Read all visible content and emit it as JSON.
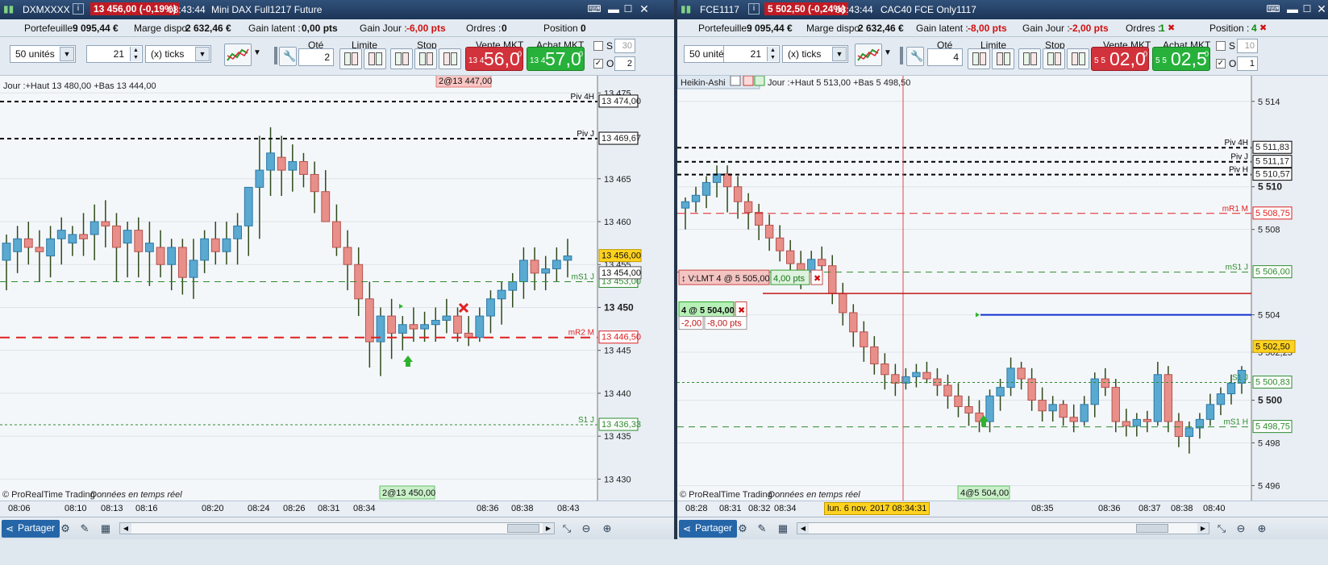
{
  "left": {
    "title": {
      "name": "DXMXXXX",
      "change": "13 456,00 (-0,19%)",
      "time": "08:43:44",
      "desc": "Mini DAX Full1217 Future"
    },
    "stats": {
      "portfolio_label": "Portefeuille :",
      "portfolio": "9 095,44 €",
      "margin_label": "Marge dispo",
      "margin": "2 632,46 €",
      "latent_label": "Gain latent :",
      "latent": "0,00 pts",
      "day_label": "Gain Jour :",
      "day": "-6,00 pts",
      "orders_label": "Ordres :",
      "orders": "0",
      "position_label": "Position :",
      "position": "0"
    },
    "toolbar": {
      "units": "50 unités",
      "qty_spin": "21",
      "ticks": "(x) ticks",
      "qty_label": "Qté",
      "qty": "2",
      "limit_label": "Limite",
      "stop_label": "Stop",
      "sell_label": "Vente MKT",
      "sell_small": "13 4",
      "sell_big": "56,0",
      "sell_sup": "0",
      "buy_label": "Achat MKT",
      "buy_small": "13 4",
      "buy_big": "57,0",
      "buy_sup": "0",
      "s_label": "S",
      "s_val": "30",
      "o_label": "O",
      "o_val": "2"
    },
    "chart": {
      "info": "Jour :+Haut 13 480,00 +Bas 13 444,00",
      "top_tag": "2@13 447,00",
      "bottom_tag": "2@13 450,00",
      "copyright": "© ProRealTime Trading",
      "realtime": "Données en temps réel"
    },
    "levels": [
      {
        "name": "Piv 4H",
        "value": "13 474,00",
        "price": 13474,
        "color": "#000",
        "dash": "5,4",
        "w": 2
      },
      {
        "name": "Piv J",
        "value": "13 469,67",
        "price": 13469.67,
        "color": "#000",
        "dash": "5,4",
        "w": 2
      },
      {
        "name": "mS1 J",
        "value": "13 453,00",
        "price": 13453,
        "color": "#2e8b2e",
        "dash": "8,6",
        "w": 1
      },
      {
        "name": "mR2 M",
        "value": "13 446,50",
        "price": 13446.5,
        "color": "#e02020",
        "dash": "12,8",
        "w": 2
      },
      {
        "name": "S1 J",
        "value": "13 436,33",
        "price": 13436.33,
        "color": "#2e8b2e",
        "dash": "3,3",
        "w": 1
      }
    ],
    "price_ticks": [
      "13 475",
      "13 465",
      "13 460",
      "13 455",
      "13 450",
      "13 445",
      "13 440",
      "13 435",
      "13 430"
    ],
    "price_tick_values": [
      13475,
      13465,
      13460,
      13455,
      13450,
      13445,
      13440,
      13435,
      13430
    ],
    "price_ymin": 13427.5,
    "price_ymax": 13477,
    "current": {
      "value": "13 456,00",
      "price": 13456
    },
    "bid": {
      "value": "13 454,00",
      "price": 13454
    },
    "time_ticks": [
      "08:06",
      "08:10",
      "08:13",
      "08:16",
      "08:20",
      "08:24",
      "08:26",
      "08:31",
      "08:34",
      "08:36",
      "08:38",
      "08:43"
    ],
    "candles": [
      [
        13455.5,
        13458.5,
        13452,
        13457.5
      ],
      [
        13456.5,
        13459.5,
        13454,
        13458
      ],
      [
        13458,
        13460,
        13455,
        13457
      ],
      [
        13457,
        13459,
        13453,
        13456.5
      ],
      [
        13456,
        13459.5,
        13453.5,
        13458
      ],
      [
        13458,
        13460.5,
        13455,
        13459
      ],
      [
        13457.5,
        13459.5,
        13456,
        13458.5
      ],
      [
        13458.5,
        13461,
        13456,
        13458
      ],
      [
        13458.5,
        13462,
        13455.5,
        13460
      ],
      [
        13460,
        13462.5,
        13457,
        13459.5
      ],
      [
        13459.5,
        13461,
        13453,
        13457
      ],
      [
        13457.5,
        13460,
        13453.5,
        13459
      ],
      [
        13459,
        13460.5,
        13453.5,
        13456.5
      ],
      [
        13456.5,
        13460,
        13452.5,
        13457.5
      ],
      [
        13457,
        13459,
        13453.5,
        13455
      ],
      [
        13455,
        13458,
        13452,
        13457
      ],
      [
        13457,
        13458,
        13451.5,
        13453.5
      ],
      [
        13453.5,
        13458,
        13451,
        13455.5
      ],
      [
        13455.5,
        13459,
        13454,
        13458
      ],
      [
        13458,
        13460,
        13455,
        13456.5
      ],
      [
        13456.5,
        13460,
        13455,
        13458
      ],
      [
        13458,
        13461,
        13455,
        13459.5
      ],
      [
        13459.5,
        13462.5,
        13456,
        13464
      ],
      [
        13464,
        13470,
        13458,
        13466
      ],
      [
        13466,
        13471,
        13463,
        13468
      ],
      [
        13467.5,
        13470,
        13463,
        13466
      ],
      [
        13466,
        13469,
        13463.5,
        13467
      ],
      [
        13467,
        13468,
        13464,
        13465.5
      ],
      [
        13465.5,
        13467,
        13461,
        13463.5
      ],
      [
        13463.5,
        13466,
        13461,
        13460
      ],
      [
        13460,
        13462,
        13456,
        13457
      ],
      [
        13457,
        13459,
        13452,
        13455
      ],
      [
        13455,
        13457,
        13449,
        13451
      ],
      [
        13451,
        13453,
        13443,
        13446
      ],
      [
        13446,
        13450,
        13442,
        13449
      ],
      [
        13449,
        13451,
        13444,
        13447
      ],
      [
        13447,
        13449,
        13445,
        13448
      ],
      [
        13448,
        13450,
        13446,
        13447.5
      ],
      [
        13447.5,
        13449.5,
        13446,
        13448
      ],
      [
        13448,
        13450,
        13446,
        13448.5
      ],
      [
        13448.5,
        13451,
        13447,
        13449
      ],
      [
        13449,
        13450,
        13446,
        13447
      ],
      [
        13447,
        13449,
        13445.5,
        13446.5
      ],
      [
        13446.5,
        13450,
        13446,
        13449
      ],
      [
        13449,
        13452,
        13447,
        13451
      ],
      [
        13451,
        13453,
        13448,
        13452
      ],
      [
        13452,
        13454,
        13450,
        13453
      ],
      [
        13453,
        13457,
        13451,
        13455.5
      ],
      [
        13455.5,
        13457,
        13452,
        13454
      ],
      [
        13454,
        13456,
        13452,
        13454.5
      ],
      [
        13454.5,
        13457,
        13453,
        13455.5
      ],
      [
        13455.5,
        13458,
        13453.5,
        13456
      ]
    ]
  },
  "right": {
    "title": {
      "name": "FCE1117",
      "change": "5 502,50 (-0,24%)",
      "time": "08:43:44",
      "desc": "CAC40 FCE Only1117"
    },
    "stats": {
      "portfolio_label": "Portefeuille :",
      "portfolio": "9 095,44 €",
      "margin_label": "Marge dispo",
      "margin": "2 632,46 €",
      "latent_label": "Gain latent :",
      "latent": "-8,00 pts",
      "day_label": "Gain Jour :",
      "day": "-2,00 pts",
      "orders_label": "Ordres :",
      "orders": "1",
      "position_label": "Position :",
      "position": "4"
    },
    "toolbar": {
      "units": "50 unités",
      "qty_spin": "21",
      "ticks": "(x) ticks",
      "qty_label": "Qté",
      "qty": "4",
      "limit_label": "Limite",
      "stop_label": "Stop",
      "sell_label": "Vente MKT",
      "sell_small": "5 5",
      "sell_big": "02,0",
      "sell_sup": "0",
      "buy_label": "Achat MKT",
      "buy_small": "5 5",
      "buy_big": "02,5",
      "buy_sup": "0",
      "s_label": "S",
      "s_val": "10",
      "o_label": "O",
      "o_val": "1"
    },
    "chart": {
      "style": "Heikin-Ashi",
      "info": "Jour :+Haut 5 513,00 +Bas 5 498,50",
      "order_label": "V:LMT  4 @ 5 505,00",
      "order_pts": "4,00 pts",
      "position_label": "4 @ 5 504,00",
      "pos_a": "-2,00",
      "pos_b": "-8,00 pts",
      "bottom_tag": "4@5 504,00",
      "crosshair_time": "lun. 6 nov. 2017 08:34:31",
      "copyright": "© ProRealTime Trading",
      "realtime": "Données en temps réel"
    },
    "levels": [
      {
        "name": "Piv 4H",
        "value": "5 511,83",
        "price": 5511.83,
        "color": "#000",
        "dash": "5,4",
        "w": 2
      },
      {
        "name": "Piv J",
        "value": "5 511,17",
        "price": 5511.17,
        "color": "#000",
        "dash": "5,4",
        "w": 2
      },
      {
        "name": "Piv H",
        "value": "5 510,57",
        "price": 5510.57,
        "color": "#000",
        "dash": "5,4",
        "w": 2
      },
      {
        "name": "mR1 M",
        "value": "5 508,75",
        "price": 5508.75,
        "color": "#e02020",
        "dash": "10,6",
        "w": 1
      },
      {
        "name": "mS1 J",
        "value": "5 506,00",
        "price": 5506,
        "color": "#2e8b2e",
        "dash": "8,6",
        "w": 1
      },
      {
        "name": "S1 J",
        "value": "5 500,83",
        "price": 5500.83,
        "color": "#2e8b2e",
        "dash": "3,3",
        "w": 1
      },
      {
        "name": "mS1 H",
        "value": "5 498,75",
        "price": 5498.75,
        "color": "#2e8b2e",
        "dash": "8,6",
        "w": 1
      }
    ],
    "price_ticks": [
      "5 514",
      "5 510",
      "5 508",
      "5 504",
      "5 502,25",
      "5 500",
      "5 498",
      "5 496"
    ],
    "price_tick_values": [
      5514,
      5510,
      5508,
      5504,
      5502.25,
      5500,
      5498,
      5496
    ],
    "price_ymin": 5495.3,
    "price_ymax": 5515.2,
    "current": {
      "value": "5 502,50",
      "price": 5502.5
    },
    "time_ticks": [
      "08:28",
      "08:31",
      "08:32",
      "08:34",
      "08:35",
      "08:36",
      "08:37",
      "08:38",
      "08:40"
    ],
    "candles": [
      [
        5509,
        5509.5,
        5508,
        5509.3
      ],
      [
        5509.3,
        5510,
        5508.8,
        5509.6
      ],
      [
        5509.6,
        5510.5,
        5509,
        5510.2
      ],
      [
        5510.2,
        5511,
        5509.5,
        5510.6
      ],
      [
        5510.6,
        5511,
        5508.8,
        5510
      ],
      [
        5510,
        5510.5,
        5508.5,
        5509.3
      ],
      [
        5509.3,
        5509.7,
        5508,
        5508.8
      ],
      [
        5508.8,
        5509.2,
        5507.5,
        5508.2
      ],
      [
        5508.2,
        5508.7,
        5507,
        5507.6
      ],
      [
        5507.6,
        5508.2,
        5506.5,
        5507
      ],
      [
        5507,
        5507.5,
        5505.8,
        5506.4
      ],
      [
        5506.4,
        5507,
        5505.2,
        5506
      ],
      [
        5506,
        5507,
        5505.5,
        5506.6
      ],
      [
        5506.6,
        5507.2,
        5505.8,
        5506.3
      ],
      [
        5506.3,
        5506.8,
        5504.5,
        5505
      ],
      [
        5505,
        5505.5,
        5503.5,
        5504.1
      ],
      [
        5504.1,
        5504.5,
        5502.5,
        5503.2
      ],
      [
        5503.2,
        5503.7,
        5501.8,
        5502.5
      ],
      [
        5502.5,
        5503,
        5501.2,
        5501.7
      ],
      [
        5501.7,
        5502.2,
        5500.5,
        5501.2
      ],
      [
        5501.2,
        5501.7,
        5500.2,
        5500.8
      ],
      [
        5500.8,
        5501.5,
        5500.5,
        5501.1
      ],
      [
        5501.1,
        5501.7,
        5500.6,
        5501.3
      ],
      [
        5501.3,
        5501.8,
        5500.8,
        5501
      ],
      [
        5501,
        5501.5,
        5500.2,
        5500.7
      ],
      [
        5500.7,
        5501.2,
        5499.6,
        5500.2
      ],
      [
        5500.2,
        5500.8,
        5499.2,
        5499.7
      ],
      [
        5499.7,
        5500.2,
        5498.8,
        5499.4
      ],
      [
        5499.4,
        5500,
        5498.5,
        5499
      ],
      [
        5499,
        5500.5,
        5498.5,
        5500.2
      ],
      [
        5500.2,
        5501,
        5499.5,
        5500.6
      ],
      [
        5500.6,
        5502,
        5500.2,
        5501.5
      ],
      [
        5501.5,
        5501.8,
        5500.5,
        5501
      ],
      [
        5501,
        5501.5,
        5499.5,
        5500
      ],
      [
        5500,
        5500.6,
        5499,
        5499.5
      ],
      [
        5499.5,
        5500.2,
        5499,
        5499.8
      ],
      [
        5499.8,
        5500,
        5498.8,
        5499.2
      ],
      [
        5499.2,
        5499.8,
        5498.5,
        5499
      ],
      [
        5499,
        5500.2,
        5498.8,
        5499.8
      ],
      [
        5499.8,
        5501.3,
        5499.2,
        5501
      ],
      [
        5501,
        5501.5,
        5500.2,
        5500.6
      ],
      [
        5500.6,
        5501,
        5498.5,
        5499
      ],
      [
        5499,
        5499.6,
        5498.3,
        5498.8
      ],
      [
        5498.8,
        5499.4,
        5498.3,
        5499.1
      ],
      [
        5499.1,
        5499.5,
        5498.5,
        5499
      ],
      [
        5499,
        5501.8,
        5498.8,
        5501.2
      ],
      [
        5501.2,
        5501.6,
        5498.5,
        5499
      ],
      [
        5499,
        5499.4,
        5497.8,
        5498.3
      ],
      [
        5498.3,
        5499,
        5497.5,
        5498.7
      ],
      [
        5498.7,
        5499.4,
        5498.2,
        5499.1
      ],
      [
        5499.1,
        5500.3,
        5498.8,
        5499.8
      ],
      [
        5499.8,
        5500.6,
        5499.3,
        5500.3
      ],
      [
        5500.3,
        5501.2,
        5499.8,
        5500.8
      ],
      [
        5500.8,
        5501.6,
        5500.3,
        5501.4
      ]
    ]
  },
  "bottom": {
    "share_label": "Partager"
  }
}
